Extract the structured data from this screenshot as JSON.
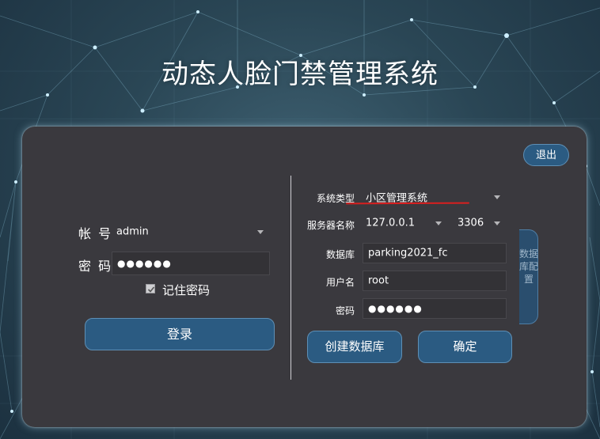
{
  "app": {
    "title": "动态人脸门禁管理系统"
  },
  "header": {
    "exit_label": "退出"
  },
  "login": {
    "account_label": "帐 号",
    "account_value": "admin",
    "password_label": "密 码",
    "password_value": "●●●●●●",
    "remember_label": "记住密码",
    "remember_checked": true,
    "login_label": "登录"
  },
  "config": {
    "system_type_label": "系统类型",
    "system_type_value": "小区管理系统",
    "server_label": "服务器名称",
    "server_value": "127.0.0.1",
    "port_value": "3306",
    "database_label": "数据库",
    "database_value": "parking2021_fc",
    "username_label": "用户名",
    "username_value": "root",
    "password_label": "密码",
    "password_value": "●●●●●●",
    "create_db_label": "创建数据库",
    "confirm_label": "确定",
    "side_tab_label": "数据库配置"
  },
  "colors": {
    "panel": "#3a393e",
    "button": "#2b5b82",
    "highlight_underline": "#d91f1f"
  }
}
